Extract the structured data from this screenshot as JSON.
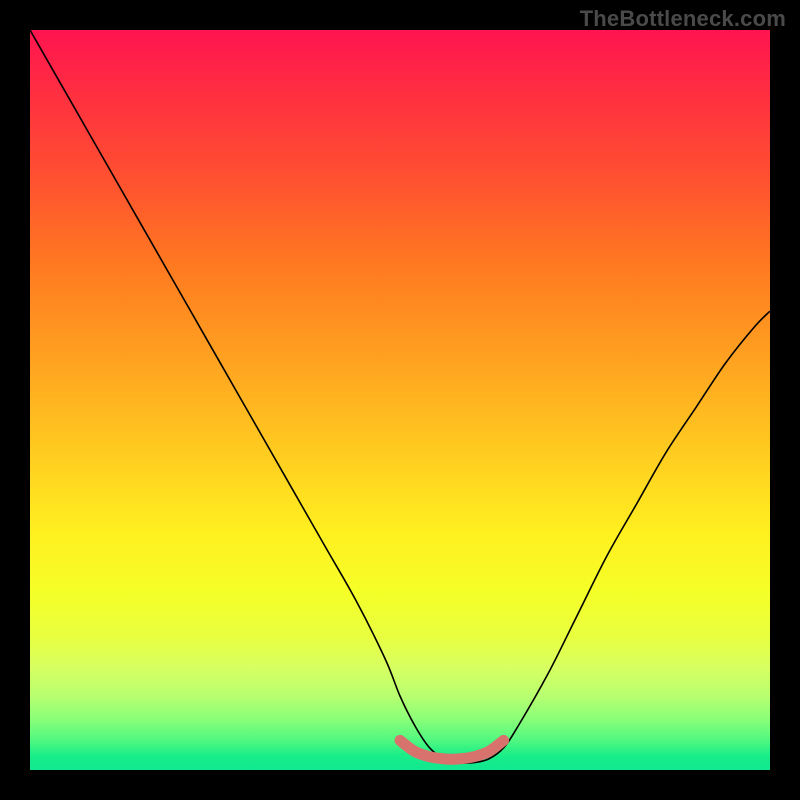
{
  "watermark": "TheBottleneck.com",
  "chart_data": {
    "type": "line",
    "title": "",
    "xlabel": "",
    "ylabel": "",
    "xlim": [
      0,
      100
    ],
    "ylim": [
      0,
      100
    ],
    "grid": false,
    "series": [
      {
        "name": "curve",
        "color": "#000000",
        "x": [
          0,
          4,
          8,
          12,
          16,
          20,
          24,
          28,
          32,
          36,
          40,
          44,
          48,
          50,
          52,
          54,
          56,
          58,
          60,
          62,
          64,
          66,
          70,
          74,
          78,
          82,
          86,
          90,
          94,
          98,
          100
        ],
        "y": [
          100,
          93,
          86,
          79,
          72,
          65,
          58,
          51,
          44,
          37,
          30,
          23,
          15,
          10,
          6,
          3,
          1.5,
          1,
          1,
          1.5,
          3,
          6,
          13,
          21,
          29,
          36,
          43,
          49,
          55,
          60,
          62
        ]
      },
      {
        "name": "trough-marker",
        "color": "#d8726c",
        "x": [
          50,
          52,
          54,
          56,
          58,
          60,
          62,
          64
        ],
        "y": [
          4,
          2.5,
          1.8,
          1.5,
          1.5,
          1.8,
          2.5,
          4
        ]
      }
    ],
    "colors": {
      "gradient_top": "#ff1450",
      "gradient_mid": "#fff020",
      "gradient_bottom": "#10e890",
      "curve": "#000000",
      "trough": "#d8726c",
      "frame": "#000000"
    }
  }
}
